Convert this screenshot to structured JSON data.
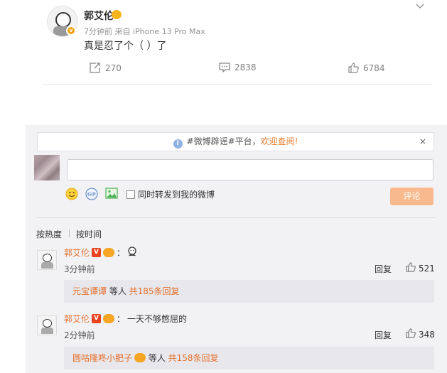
{
  "post": {
    "author": "郭艾伦",
    "meta": "7分钟前 来自 iPhone 13 Pro Max",
    "text": "真是忍了个（ ）了",
    "reposts": "270",
    "comments": "2838",
    "likes": "6784",
    "avatar_badge": "v"
  },
  "notice": {
    "icon": "i",
    "prefix": "#微博辟谣#平台，",
    "welcome": "欢迎查阅!",
    "close": "×"
  },
  "composer": {
    "value": "",
    "forward_label": "同时转发到我的微博",
    "submit_label": "评论"
  },
  "sort": {
    "hot": "按热度",
    "time": "按时间"
  },
  "comments": [
    {
      "name": "郭艾伦",
      "v": "V",
      "sep": "：",
      "text": "",
      "time": "3分钟前",
      "reply": "回复",
      "likes": "521",
      "sub_name": "元宝谭谭",
      "sub_mid": " 等人 ",
      "sub_more": "共185条回复"
    },
    {
      "name": "郭艾伦",
      "v": "V",
      "sep": "：",
      "text": "一天不够憋屈的",
      "time": "2分钟前",
      "reply": "回复",
      "likes": "348",
      "sub_name": "圆咕隆咚小肥子",
      "sub_mid": " 等人 ",
      "sub_more": "共158条回复"
    }
  ],
  "colors": {
    "accent_orange": "#e46f2c",
    "submit_button": "#f8b98e",
    "panel_bg": "#f2f2f5",
    "v_tag": "#e8421f"
  }
}
